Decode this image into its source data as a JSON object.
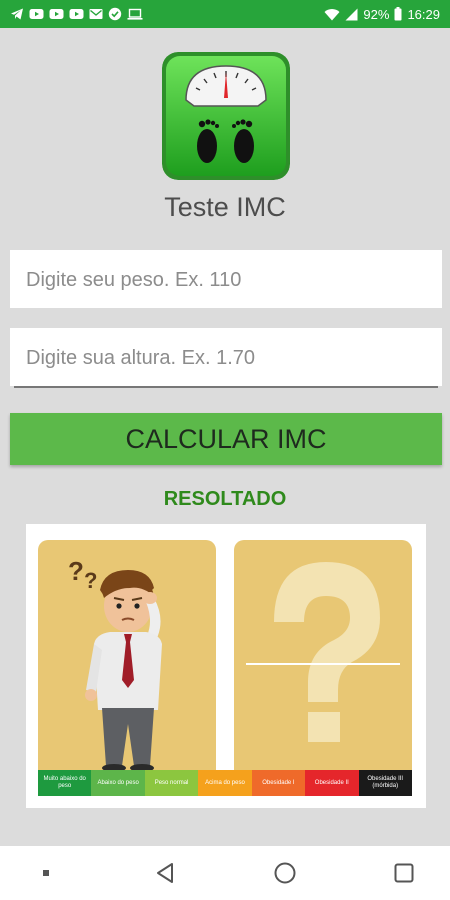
{
  "status_bar": {
    "battery": "92%",
    "time": "16:29",
    "left_icons": [
      "telegram-icon",
      "youtube-icon",
      "youtube-icon",
      "youtube-icon",
      "gmail-icon",
      "check-circle-icon",
      "laptop-icon"
    ],
    "right_icons": [
      "wifi-icon",
      "signal-icon",
      "battery-icon"
    ]
  },
  "app": {
    "title": "Teste IMC",
    "logo_icon": "scale-footprints-icon"
  },
  "form": {
    "weight_placeholder": "Digite seu peso. Ex. 110",
    "height_placeholder": "Digite sua altura. Ex. 1.70",
    "calculate_label": "CALCULAR IMC"
  },
  "result": {
    "title": "RESOLTADO",
    "image_left": "confused-man-illustration",
    "image_right": "question-mark-icon",
    "scale": [
      {
        "label": "Muito abaixo do peso",
        "color": "#1e9a3f"
      },
      {
        "label": "Abaixo do peso",
        "color": "#5db54a"
      },
      {
        "label": "Peso normal",
        "color": "#8cc63f"
      },
      {
        "label": "Acima do peso",
        "color": "#f5a11c"
      },
      {
        "label": "Obesidade I",
        "color": "#ef6a2a"
      },
      {
        "label": "Obesidade II",
        "color": "#e5262b"
      },
      {
        "label": "Obesidade III (mórbida)",
        "color": "#1a1a1a"
      }
    ]
  },
  "colors": {
    "status_bar": "#27a53b",
    "button": "#5cb94a",
    "result_title": "#2f8a1c",
    "background": "#dcdcdc"
  },
  "nav_bar": {
    "buttons": [
      "menu-dot-icon",
      "back-icon",
      "home-icon",
      "recents-icon"
    ]
  }
}
